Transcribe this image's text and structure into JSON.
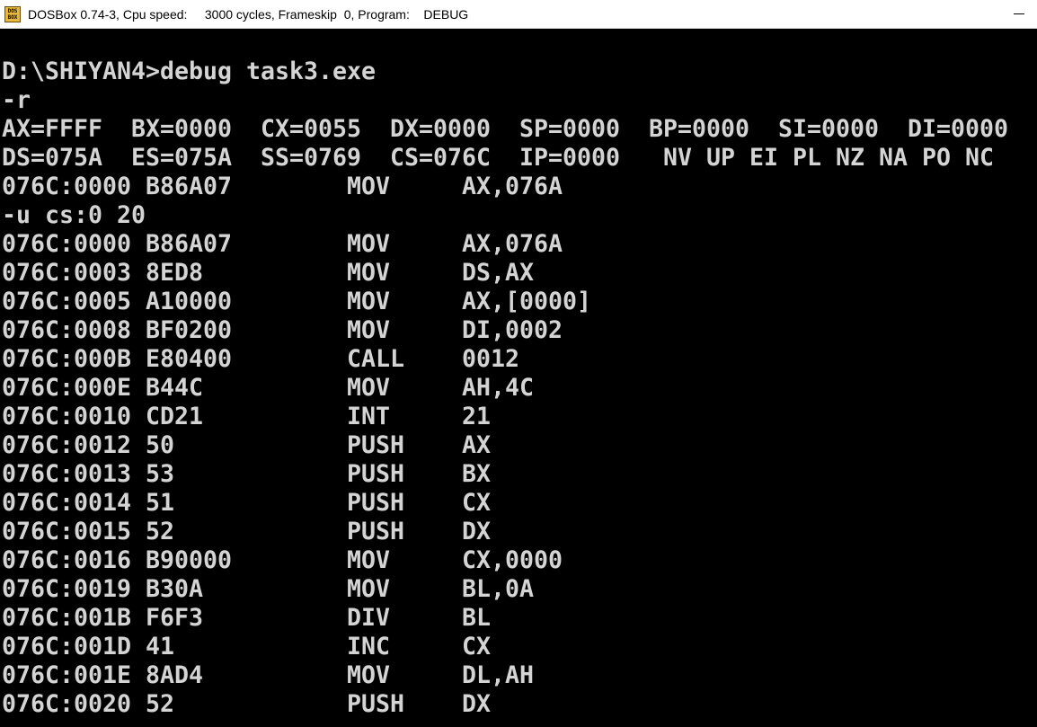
{
  "window": {
    "title": "DOSBox 0.74-3, Cpu speed:     3000 cycles, Frameskip  0, Program:    DEBUG",
    "icon": "dosbox-icon",
    "icon_text": "DOS BOX",
    "minimize_icon": "minimize-icon"
  },
  "colors": {
    "background": "#000000",
    "text": "#d4d4d4",
    "titlebar": "#ffffff"
  },
  "console": {
    "lines": [
      "",
      "D:\\SHIYAN4>debug task3.exe",
      "-r",
      "AX=FFFF  BX=0000  CX=0055  DX=0000  SP=0000  BP=0000  SI=0000  DI=0000",
      "DS=075A  ES=075A  SS=0769  CS=076C  IP=0000   NV UP EI PL NZ NA PO NC",
      "076C:0000 B86A07        MOV     AX,076A",
      "-u cs:0 20",
      "076C:0000 B86A07        MOV     AX,076A",
      "076C:0003 8ED8          MOV     DS,AX",
      "076C:0005 A10000        MOV     AX,[0000]",
      "076C:0008 BF0200        MOV     DI,0002",
      "076C:000B E80400        CALL    0012",
      "076C:000E B44C          MOV     AH,4C",
      "076C:0010 CD21          INT     21",
      "076C:0012 50            PUSH    AX",
      "076C:0013 53            PUSH    BX",
      "076C:0014 51            PUSH    CX",
      "076C:0015 52            PUSH    DX",
      "076C:0016 B90000        MOV     CX,0000",
      "076C:0019 B30A          MOV     BL,0A",
      "076C:001B F6F3          DIV     BL",
      "076C:001D 41            INC     CX",
      "076C:001E 8AD4          MOV     DL,AH",
      "076C:0020 52            PUSH    DX"
    ]
  }
}
